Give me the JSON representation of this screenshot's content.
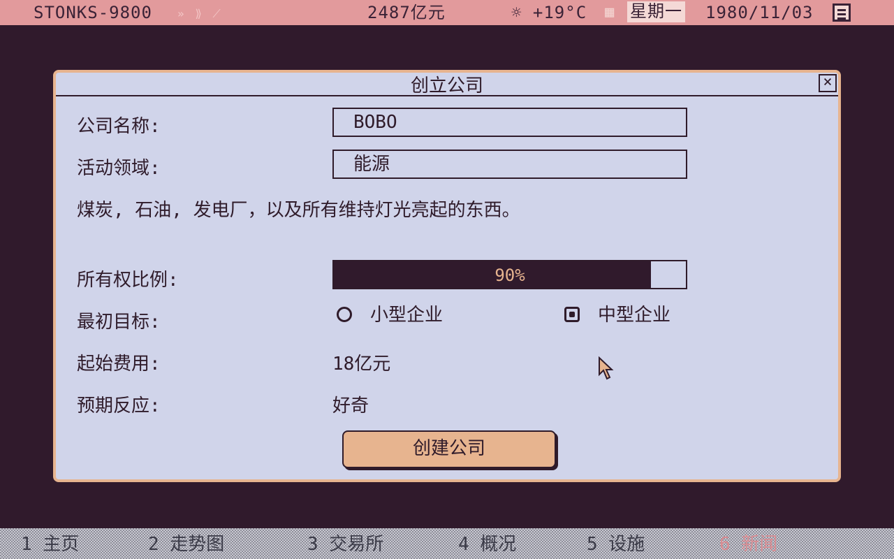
{
  "topbar": {
    "app_name": "STONKS-9800",
    "status_icons": "»  ⟫  ⟋",
    "money": "2487亿元",
    "weather": "☼ +19°C",
    "calendar_icon": "▦",
    "weekday": "星期一",
    "date": "1980/11/03"
  },
  "dialog": {
    "title": "创立公司",
    "close_label": "×",
    "company_name_label": "公司名称:",
    "company_name_value": "BOBO",
    "field_label": "活动领域:",
    "field_value": "能源",
    "description": "煤炭, 石油, 发电厂，以及所有维持灯光亮起的东西。",
    "ownership_label": "所有权比例:",
    "ownership_percent": 90,
    "ownership_text": "90%",
    "goal_label": "最初目标:",
    "goal_options": [
      {
        "label": "小型企业",
        "selected": false
      },
      {
        "label": "中型企业",
        "selected": true
      }
    ],
    "cost_label": "起始费用:",
    "cost_value": "18亿元",
    "reaction_label": "预期反应:",
    "reaction_value": "好奇",
    "create_button": "创建公司"
  },
  "nav": {
    "items": [
      {
        "label": "1 主页",
        "active": false
      },
      {
        "label": "2 走势图",
        "active": false
      },
      {
        "label": "3 交易所",
        "active": false
      },
      {
        "label": "4 概况",
        "active": false
      },
      {
        "label": "5 设施",
        "active": false
      },
      {
        "label": "6 新闻",
        "active": true
      }
    ]
  },
  "colors": {
    "background": "#301a2c",
    "topbar": "#e29a9c",
    "dialog_bg": "#d0d4ea",
    "accent": "#e7b48f",
    "text": "#2f1b2a"
  }
}
